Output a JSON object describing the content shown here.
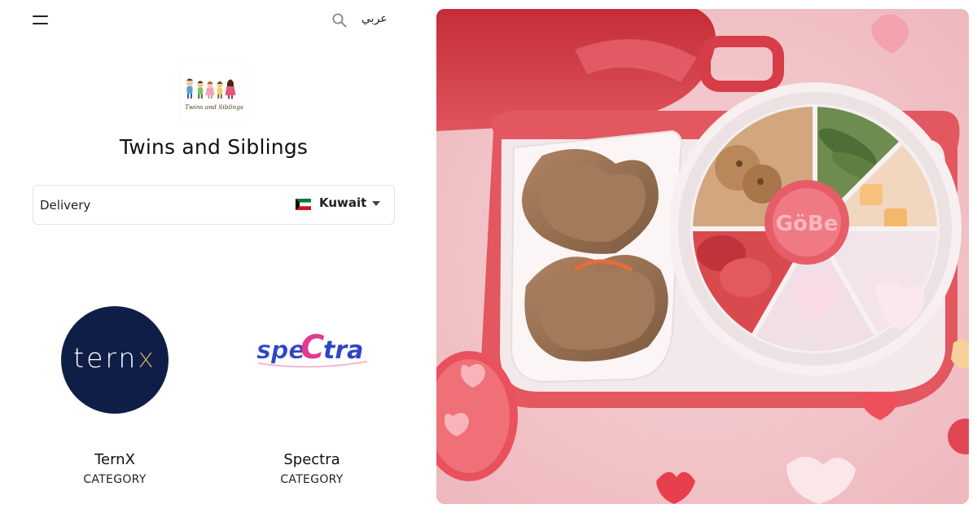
{
  "header": {
    "menu_icon": "hamburger-menu-icon",
    "search_icon": "search-icon",
    "language_link": "عربي"
  },
  "store": {
    "logo_caption": "Twins and Siblings",
    "title": "Twins and Siblings"
  },
  "delivery": {
    "mode_label": "Delivery",
    "country": "Kuwait",
    "country_flag_icon": "kuwait-flag-icon",
    "dropdown_icon": "caret-down-icon"
  },
  "categories": [
    {
      "name": "TernX",
      "type_label": "CATEGORY",
      "logo_text": "ternx",
      "logo_color": "#0e1e47",
      "accent": "#c9a86a"
    },
    {
      "name": "Spectra",
      "type_label": "CATEGORY",
      "logo_text": "speCtra",
      "logo_color": "#2f45c8",
      "accent": "#e23a8f"
    }
  ],
  "hero": {
    "image_icon": "lunchbox-photo",
    "product_brand_text": "GöBe",
    "background_color": "#f1c6ca",
    "lid_color": "#d63d48"
  }
}
